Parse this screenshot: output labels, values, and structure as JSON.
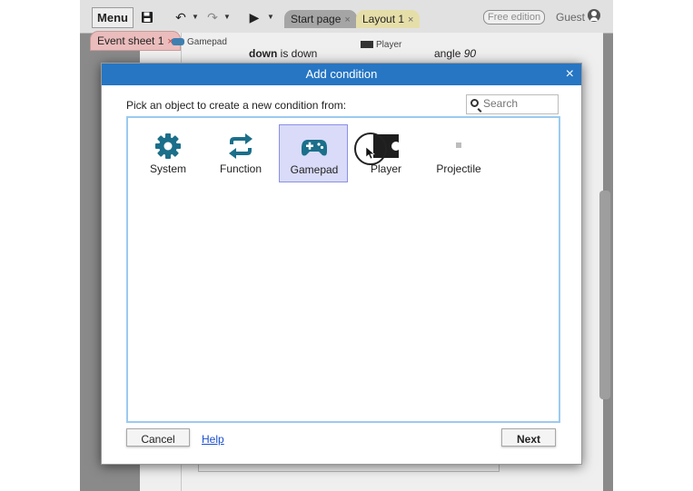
{
  "toolbar": {
    "menu_label": "Menu",
    "tabs": [
      {
        "label": "Start page",
        "close": "×"
      },
      {
        "label": "Layout 1",
        "close": "×"
      }
    ],
    "edition_badge": "Free edition",
    "user_label": "Guest"
  },
  "event_sheet_tab": {
    "label": "Event sheet 1",
    "close": "×"
  },
  "background": {
    "gamepad_chip": "Gamepad",
    "condition_key": "down",
    "condition_rest": " is down",
    "player_chip": "Player",
    "action_prefix": "angle ",
    "action_value": "90"
  },
  "dialog": {
    "title": "Add condition",
    "close": "×",
    "prompt": "Pick an object to create a new condition from:",
    "search_placeholder": "Search",
    "objects": [
      {
        "label": "System",
        "icon": "gear-icon",
        "selected": false
      },
      {
        "label": "Function",
        "icon": "function-icon",
        "selected": false
      },
      {
        "label": "Gamepad",
        "icon": "gamepad-icon",
        "selected": true
      },
      {
        "label": "Player",
        "icon": "player-sprite-icon",
        "selected": false
      },
      {
        "label": "Projectile",
        "icon": "projectile-sprite-icon",
        "selected": false
      }
    ],
    "cancel_label": "Cancel",
    "help_label": "Help",
    "next_label": "Next"
  },
  "colors": {
    "title_bar": "#2676c4",
    "list_border": "#9ccaf0",
    "icon_teal": "#1b6f8a",
    "selection": "#d9dbf8"
  }
}
